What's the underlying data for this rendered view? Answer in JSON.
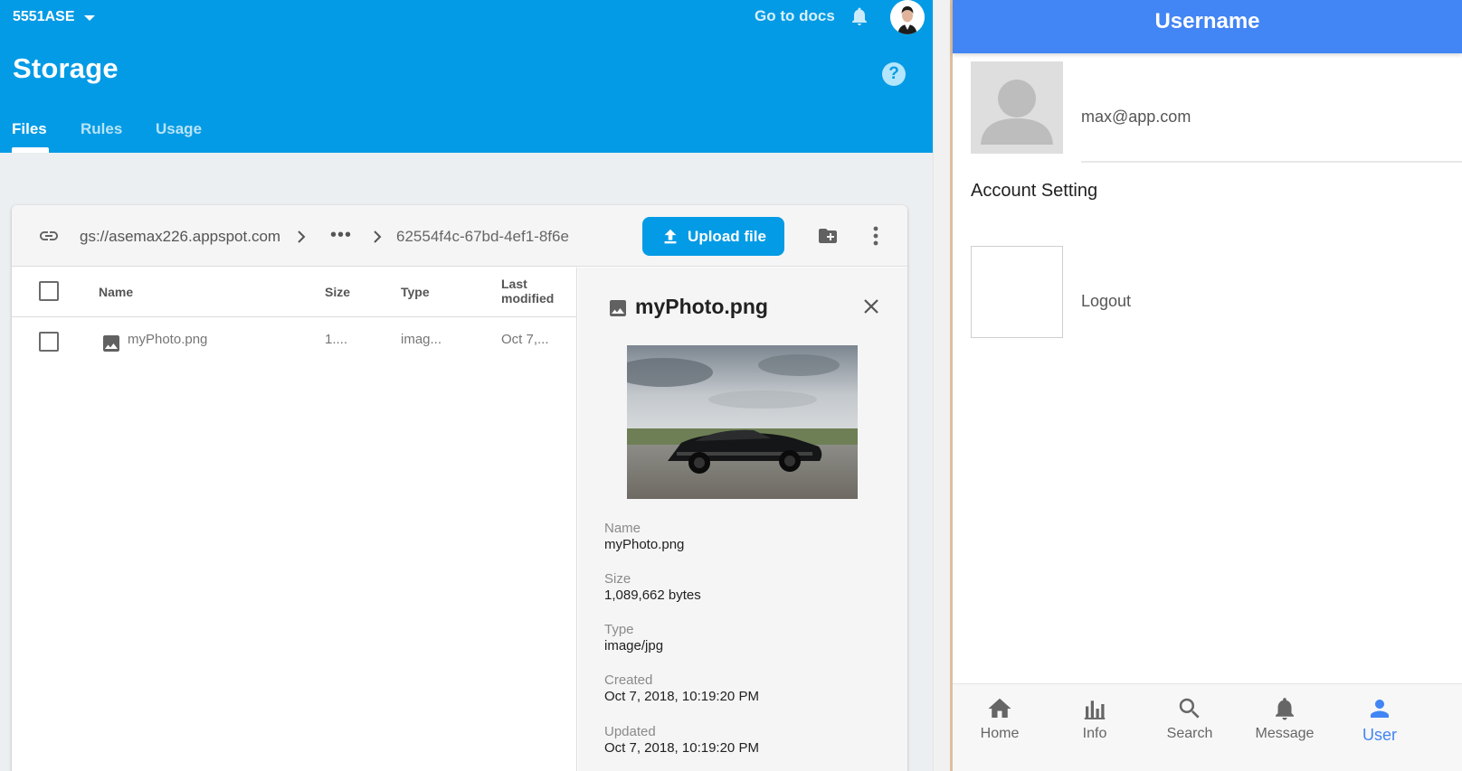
{
  "console": {
    "project_name": "5551ASE",
    "go_to_docs": "Go to docs",
    "page_title": "Storage",
    "help_symbol": "?",
    "tabs": [
      {
        "label": "Files",
        "active": true
      },
      {
        "label": "Rules",
        "active": false
      },
      {
        "label": "Usage",
        "active": false
      }
    ],
    "path": {
      "bucket": "gs://asemax226.appspot.com",
      "ellipsis": "•••",
      "folder": "62554f4c-67bd-4ef1-8f6e"
    },
    "upload_label": "Upload file",
    "table": {
      "headers": {
        "name": "Name",
        "size": "Size",
        "type": "Type",
        "modified_line1": "Last",
        "modified_line2": "modified"
      },
      "rows": [
        {
          "name": "myPhoto.png",
          "size": "1....",
          "type": "imag...",
          "modified": "Oct 7,..."
        }
      ]
    },
    "details": {
      "title": "myPhoto.png",
      "fields": [
        {
          "label": "Name",
          "value": "myPhoto.png"
        },
        {
          "label": "Size",
          "value": "1,089,662 bytes"
        },
        {
          "label": "Type",
          "value": "image/jpg"
        },
        {
          "label": "Created",
          "value": "Oct 7, 2018, 10:19:20 PM"
        },
        {
          "label": "Updated",
          "value": "Oct 7, 2018, 10:19:20 PM"
        }
      ]
    },
    "colors": {
      "primary": "#039be5",
      "background": "#eceff1"
    }
  },
  "app": {
    "header_title": "Username",
    "email": "max@app.com",
    "account_setting": "Account Setting",
    "logout": "Logout",
    "nav": [
      {
        "label": "Home",
        "icon": "home-icon",
        "active": false
      },
      {
        "label": "Info",
        "icon": "bar-chart-icon",
        "active": false
      },
      {
        "label": "Search",
        "icon": "search-icon",
        "active": false
      },
      {
        "label": "Message",
        "icon": "bell-icon",
        "active": false
      },
      {
        "label": "User",
        "icon": "person-icon",
        "active": true
      }
    ],
    "colors": {
      "header": "#4285f4",
      "active_nav": "#4285f4"
    }
  }
}
